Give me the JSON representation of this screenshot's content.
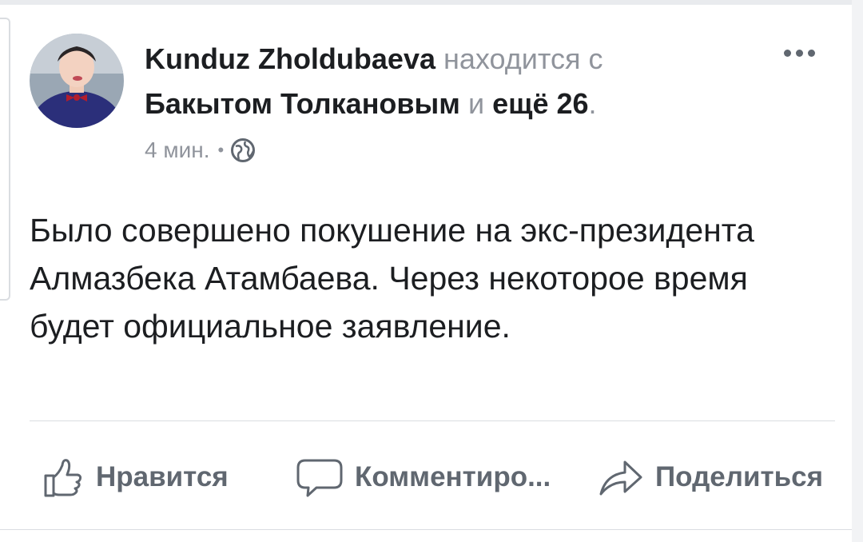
{
  "post": {
    "author_name": "Kunduz Zholdubaeva",
    "with_text": "находится с",
    "tagged_person": "Бакытом Толкановым",
    "and_text": "и",
    "others_text": "ещё 26",
    "period": ".",
    "time_label": "4 мин.",
    "separator": "•",
    "body_text": "Было совершено покушение на экс-президента Алмазбека Атамбаева. Через некоторое время будет официальное заявление."
  },
  "actions": {
    "like_label": "Нравится",
    "comment_label": "Комментиро...",
    "share_label": "Поделиться"
  },
  "icons": {
    "avatar": "author-avatar",
    "audience": "globe-icon",
    "more": "more-options-icon",
    "like": "thumbs-up-icon",
    "comment": "speech-bubble-icon",
    "share": "share-arrow-icon"
  },
  "colors": {
    "text_primary": "#1c1e21",
    "text_secondary": "#90949c",
    "action_text": "#606770",
    "divider": "#dadde1"
  }
}
